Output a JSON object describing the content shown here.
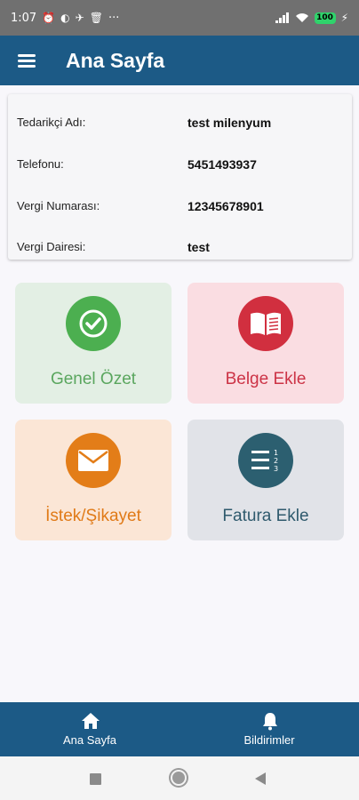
{
  "status": {
    "time": "1:07",
    "dots": "···",
    "battery": "100"
  },
  "appbar": {
    "title": "Ana Sayfa"
  },
  "supplier": {
    "rows": [
      {
        "label": "Tedarikçi Adı:",
        "value": "test milenyum"
      },
      {
        "label": "Telefonu:",
        "value": "5451493937"
      },
      {
        "label": "Vergi Numarası:",
        "value": "12345678901"
      },
      {
        "label": "Vergi Dairesi:",
        "value": "test"
      }
    ]
  },
  "tiles": [
    {
      "label": "Genel Özet",
      "icon": "check-icon",
      "bg": "#e3efe4",
      "circle": "#4caf50",
      "text": "#5aa65e"
    },
    {
      "label": "Belge Ekle",
      "icon": "book-icon",
      "bg": "#fadde2",
      "circle": "#d12f3f",
      "text": "#cc3346"
    },
    {
      "label": "İstek/Şikayet",
      "icon": "mail-icon",
      "bg": "#fbe6d6",
      "circle": "#e37d18",
      "text": "#e07a17"
    },
    {
      "label": "Fatura Ekle",
      "icon": "list-icon",
      "bg": "#e1e3e8",
      "circle": "#2c5f70",
      "text": "#2f5a6d"
    }
  ],
  "bottom_nav": [
    {
      "label": "Ana Sayfa",
      "icon": "home-icon"
    },
    {
      "label": "Bildirimler",
      "icon": "bell-icon"
    }
  ],
  "system_nav": [
    "recents-button",
    "home-button",
    "back-button"
  ]
}
